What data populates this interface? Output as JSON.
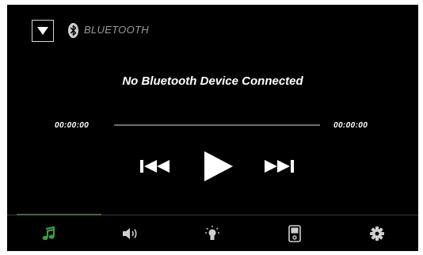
{
  "header": {
    "source_label": "BLUETOOTH",
    "dropdown_icon": "triangle-down-icon",
    "source_icon": "bluetooth-icon"
  },
  "status_text": "No Bluetooth Device Connected",
  "playback": {
    "elapsed": "00:00:00",
    "total": "00:00:00",
    "progress": 0,
    "controls": [
      "previous-track-icon",
      "play-icon",
      "next-track-icon"
    ]
  },
  "nav": {
    "active": "music",
    "items": [
      {
        "id": "music",
        "icon": "music-note-icon"
      },
      {
        "id": "audio",
        "icon": "speaker-icon"
      },
      {
        "id": "lighting",
        "icon": "light-bulb-icon"
      },
      {
        "id": "device",
        "icon": "device-icon"
      },
      {
        "id": "settings",
        "icon": "gear-icon"
      }
    ]
  },
  "colors": {
    "background": "#000000",
    "text": "#ffffff",
    "label_gray": "#9a9a9a",
    "accent_green": "#3f9b3f",
    "icon_gray": "#cfcfcf"
  }
}
